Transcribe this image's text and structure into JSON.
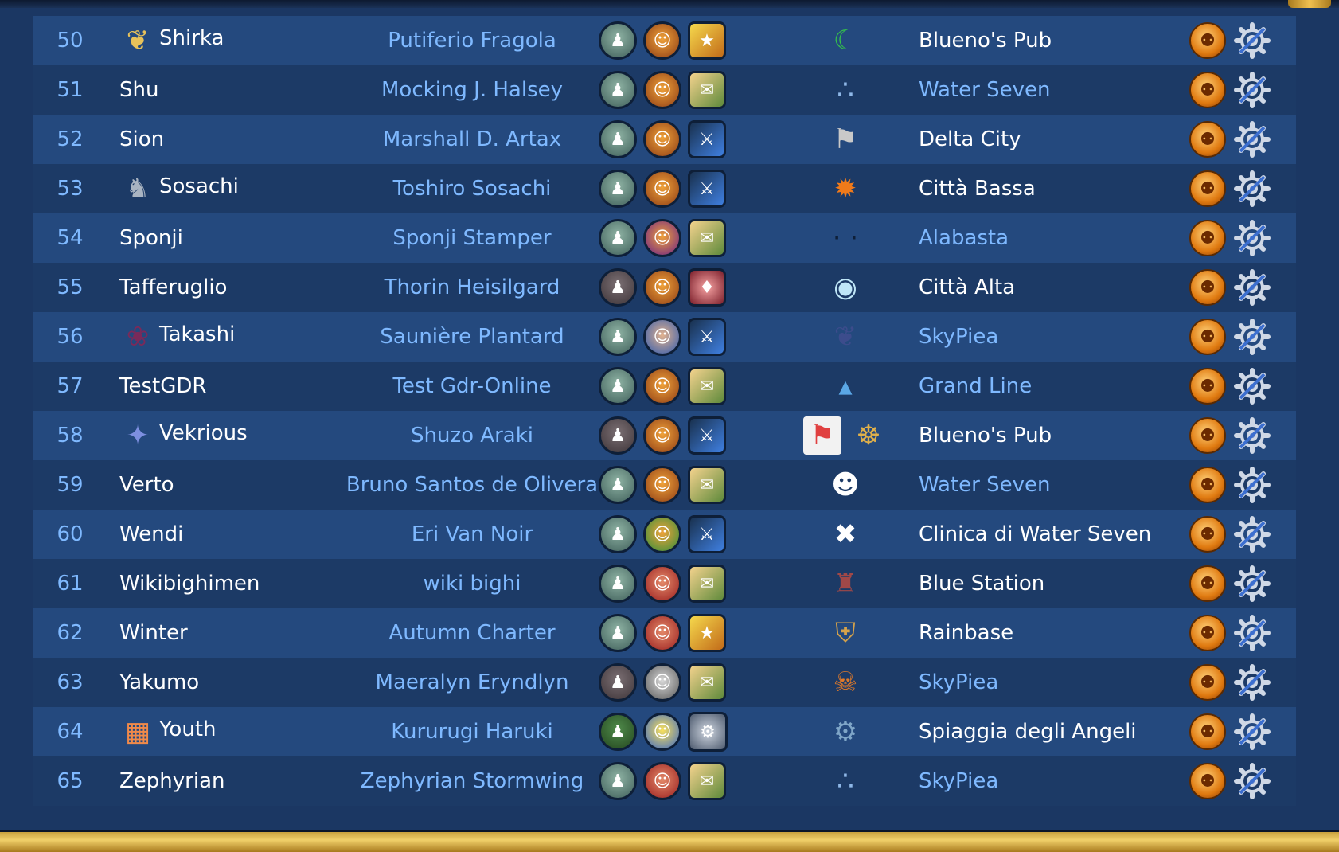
{
  "colors": {
    "row_odd": "#24497e",
    "row_even": "#1c3a66",
    "link_blue": "#7fb9ff",
    "text_white": "#ffffff",
    "frame_gold": "#e6be55"
  },
  "rows": [
    {
      "num": "50",
      "user": "Shirka",
      "character": "Putiferio Fragola",
      "location": "Blueno's Pub",
      "location_color": "white",
      "avatar": "golden-crest-icon",
      "rank": "rank-medal-icon",
      "face": "character-face-icon",
      "tool": "star-tool-icon",
      "faction": "green-swirl-icon"
    },
    {
      "num": "51",
      "user": "Shu",
      "character": "Mocking J. Halsey",
      "location": "Water Seven",
      "location_color": "blue",
      "avatar": "",
      "rank": "rank-medal-icon",
      "face": "character-face-icon",
      "tool": "map-tool-icon",
      "faction": "three-dots-icon"
    },
    {
      "num": "52",
      "user": "Sion",
      "character": "Marshall D. Artax",
      "location": "Delta City",
      "location_color": "white",
      "avatar": "",
      "rank": "rank-medal-icon",
      "face": "character-face-icon",
      "tool": "sword-tool-icon",
      "faction": "pirate-flag-icon"
    },
    {
      "num": "53",
      "user": "Sosachi",
      "character": "Toshiro Sosachi",
      "location": "Città Bassa",
      "location_color": "white",
      "avatar": "knight-avatar-icon",
      "rank": "rank-medal-icon",
      "face": "character-face-icon",
      "tool": "sword-tool-icon",
      "faction": "orange-sun-icon"
    },
    {
      "num": "54",
      "user": "Sponji",
      "character": "Sponji Stamper",
      "location": "Alabasta",
      "location_color": "blue",
      "avatar": "",
      "rank": "rank-medal-icon",
      "face": "character-face-icon",
      "tool": "map-tool-icon",
      "faction": "empty-faction-icon"
    },
    {
      "num": "55",
      "user": "Tafferuglio",
      "character": "Thorin Heisilgard",
      "location": "Città Alta",
      "location_color": "white",
      "avatar": "",
      "rank": "rank-dark-icon",
      "face": "grinning-face-icon",
      "tool": "shield-tool-icon",
      "faction": "eye-icon"
    },
    {
      "num": "56",
      "user": "Takashi",
      "character": "Saunière Plantard",
      "location": "SkyPiea",
      "location_color": "blue",
      "avatar": "fruit-avatar-icon",
      "rank": "rank-medal-icon",
      "face": "character-face-icon",
      "tool": "sword-tool-icon",
      "faction": "eagle-icon"
    },
    {
      "num": "57",
      "user": "TestGDR",
      "character": "Test Gdr-Online",
      "location": "Grand Line",
      "location_color": "blue",
      "avatar": "",
      "rank": "rank-medal-icon",
      "face": "character-face-icon",
      "tool": "map-tool-icon",
      "faction": "water-drop-icon"
    },
    {
      "num": "58",
      "user": "Vekrious",
      "character": "Shuzo Araki",
      "location": "Blueno's Pub",
      "location_color": "white",
      "avatar": "star-avatar-icon",
      "rank": "rank-dark-icon",
      "face": "character-face-icon",
      "tool": "sword-tool-icon",
      "faction": "ship-wheel-icon"
    },
    {
      "num": "59",
      "user": "Verto",
      "character": "Bruno Santos de Olivera",
      "location": "Water Seven",
      "location_color": "blue",
      "avatar": "",
      "rank": "rank-medal-icon",
      "face": "character-face-icon",
      "tool": "map-tool-icon",
      "faction": "jolly-face-icon"
    },
    {
      "num": "60",
      "user": "Wendi",
      "character": "Eri Van Noir",
      "location": "Clinica di Water Seven",
      "location_color": "white",
      "avatar": "",
      "rank": "rank-medal-icon",
      "face": "character-face-icon",
      "tool": "sword-tool-icon",
      "faction": "crossed-bones-icon"
    },
    {
      "num": "61",
      "user": "Wikibighimen",
      "character": "wiki bighi",
      "location": "Blue Station",
      "location_color": "white",
      "avatar": "",
      "rank": "rank-medal-icon",
      "face": "character-face-icon",
      "tool": "map-tool-icon",
      "faction": "small-tower-icon"
    },
    {
      "num": "62",
      "user": "Winter",
      "character": "Autumn Charter",
      "location": "Rainbase",
      "location_color": "white",
      "avatar": "",
      "rank": "rank-medal-icon",
      "face": "character-face-icon",
      "tool": "star-tool-icon",
      "faction": "shield-emblem-icon"
    },
    {
      "num": "63",
      "user": "Yakumo",
      "character": "Maeralyn Eryndlyn",
      "location": "SkyPiea",
      "location_color": "blue",
      "avatar": "",
      "rank": "rank-dark-icon",
      "face": "character-face-icon",
      "tool": "map-tool-icon",
      "faction": "skull-hat-icon"
    },
    {
      "num": "64",
      "user": "Youth",
      "character": "Kururugi Haruki",
      "location": "Spiaggia degli Angeli",
      "location_color": "white",
      "avatar": "pixel-avatar-icon",
      "rank": "rank-green-icon",
      "face": "character-face-icon",
      "tool": "gear-tool-icon",
      "faction": "robot-icon"
    },
    {
      "num": "65",
      "user": "Zephyrian",
      "character": "Zephyrian Stormwing",
      "location": "SkyPiea",
      "location_color": "blue",
      "avatar": "",
      "rank": "rank-medal-icon",
      "face": "character-face-icon",
      "tool": "map-tool-icon",
      "faction": "three-dots-icon"
    }
  ]
}
